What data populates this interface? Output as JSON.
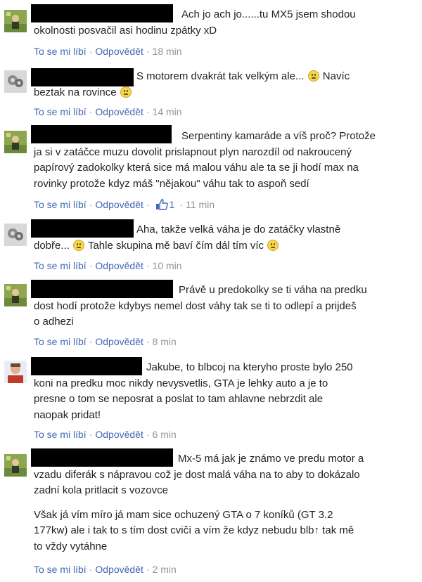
{
  "labels": {
    "like": "To se mi líbí",
    "reply": "Odpovědět",
    "dot": "·"
  },
  "comments": [
    {
      "lines": [
        "Ach jo ach jo......tu MX5 jsem shodou",
        "okolnosti posvačil asi hodinu zpátky xD"
      ],
      "time": "18 min"
    },
    {
      "lines": [
        "S motorem dvakrát tak velkým ale...",
        "Navíc",
        "beztak na rovince"
      ],
      "time": "14 min"
    },
    {
      "lines": [
        "Serpentiny kamaráde a víš proč? Protože",
        "ja si v zatáčce muzu dovolit prislapnout plyn narozdíl od nakroucený",
        "papírový zadokolky která sice má malou váhu ale ta se ji hodí max na",
        "rovinky protože kdyz máš \"nějakou\" váhu tak to aspoň sedí"
      ],
      "time": "11 min",
      "likes": "1"
    },
    {
      "lines": [
        "Aha, takže velká váha je do zatáčky vlastně",
        "dobře...",
        "Tahle skupina mě baví čím dál tím víc"
      ],
      "time": "10 min"
    },
    {
      "lines": [
        "Právě u predokolky se ti váha na predku",
        "dost hodí protože kdybys nemel dost váhy tak se ti to odlepí a prijdeš",
        "o adhezi"
      ],
      "time": "8 min"
    },
    {
      "lines": [
        "Jakube, to blbcoj na kteryho proste bylo 250",
        "koni na predku moc nikdy nevysvetlis, GTA je lehky auto a je to",
        "presne o tom se neposrat a poslat to tam ahlavne nebrzdit ale",
        "naopak pridat!"
      ],
      "time": "6 min"
    },
    {
      "lines": [
        "Mx-5 má jak je známo ve predu motor a",
        "vzadu diferák s nápravou což je dost malá váha na to aby to dokázalo",
        "zadní kola pritlacit s vozovce",
        "Však já vím míro já mam sice ochuzený GTA o 7 koníků (GT 3.2",
        "177kw) ale i tak to s tím dost cvičí a vím že kdyz nebudu blb↑ tak mě",
        "to vždy vytáhne"
      ],
      "time": "2 min"
    }
  ],
  "colors": {
    "link": "#4267b2",
    "meta_gray": "#90949c",
    "text": "#1d2129"
  }
}
